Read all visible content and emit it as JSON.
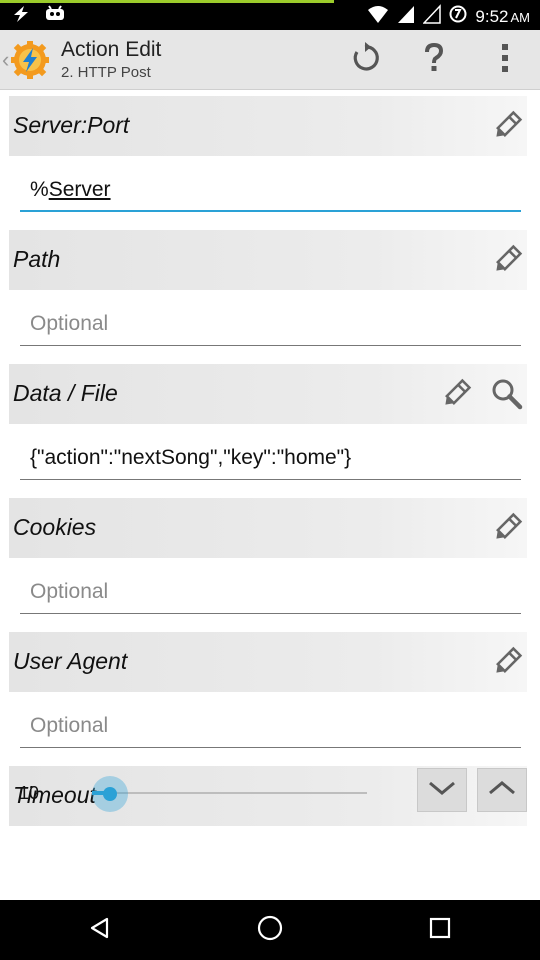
{
  "status_bar": {
    "time": "9:52",
    "ampm": "AM",
    "progress_color": "#9ccc2b",
    "left_icons": [
      "flash-notification-icon",
      "android-debug-icon"
    ],
    "right_icons": [
      "wifi-icon",
      "signal-icon",
      "signal-icon-2",
      "data-saver-icon"
    ]
  },
  "action_bar": {
    "title": "Action Edit",
    "subtitle": "2. HTTP Post",
    "icons": [
      "app-tasker-icon",
      "undo-icon",
      "help-icon",
      "overflow-menu-icon"
    ]
  },
  "sections": [
    {
      "label": "Server:Port",
      "value": "%Server",
      "placeholder": "",
      "icons": [
        "edit-pencil-icon"
      ],
      "focused": true
    },
    {
      "label": "Path",
      "value": "",
      "placeholder": "Optional",
      "icons": [
        "edit-pencil-icon"
      ],
      "focused": false
    },
    {
      "label": "Data / File",
      "value": "{\"action\":\"nextSong\",\"key\":\"home\"}",
      "placeholder": "",
      "icons": [
        "edit-pencil-icon",
        "search-icon"
      ],
      "focused": false
    },
    {
      "label": "Cookies",
      "value": "",
      "placeholder": "Optional",
      "icons": [
        "edit-pencil-icon"
      ],
      "focused": false
    },
    {
      "label": "User Agent",
      "value": "",
      "placeholder": "Optional",
      "icons": [
        "edit-pencil-icon"
      ],
      "focused": false
    }
  ],
  "timeout": {
    "label": "Timeout",
    "value": "10",
    "slider_fraction": 0.0
  },
  "accent_color": "#2aa1d6",
  "nav_bar": {
    "icons": [
      "back-icon",
      "home-icon",
      "recents-icon"
    ]
  }
}
